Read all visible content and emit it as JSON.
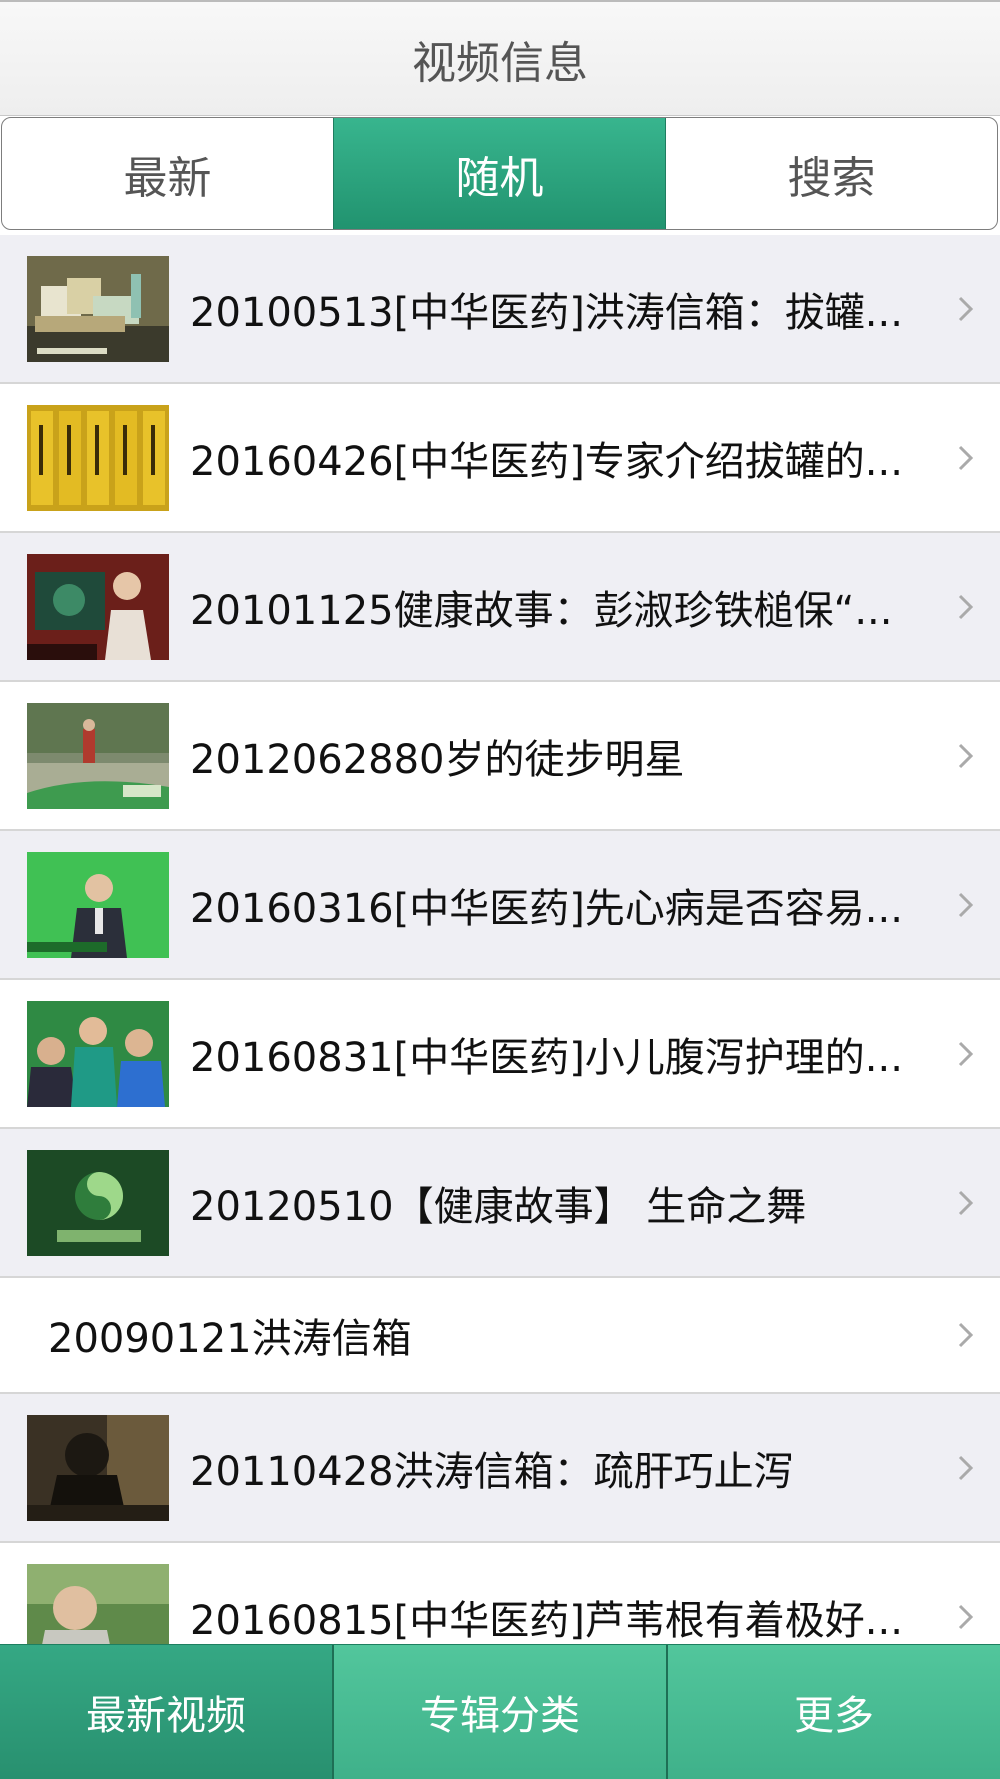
{
  "header": {
    "title": "视频信息"
  },
  "segments": [
    {
      "label": "最新",
      "active": false
    },
    {
      "label": "随机",
      "active": true
    },
    {
      "label": "搜索",
      "active": false
    }
  ],
  "videos": [
    {
      "title": "20100513[中华医药]洪涛信箱：拔罐...",
      "thumb": "product-boxes"
    },
    {
      "title": "20160426[中华医药]专家介绍拔罐的...",
      "thumb": "yellow-scrolls"
    },
    {
      "title": "20101125健康故事：彭淑珍铁槌保“...",
      "thumb": "host-studio"
    },
    {
      "title": "2012062880岁的徒步明星",
      "thumb": "walker-outdoor"
    },
    {
      "title": "20160316[中华医药]先心病是否容易...",
      "thumb": "doctor-green"
    },
    {
      "title": "20160831[中华医药]小儿腹泻护理的...",
      "thumb": "family-interview"
    },
    {
      "title": "20120510【健康故事】 生命之舞",
      "thumb": "program-logo"
    },
    {
      "title": "20090121洪涛信箱",
      "thumb": null
    },
    {
      "title": "20110428洪涛信箱：疏肝巧止泻",
      "thumb": "dark-interview"
    },
    {
      "title": "20160815[中华医药]芦苇根有着极好...",
      "thumb": "elder-outdoor"
    }
  ],
  "tabbar": [
    {
      "label": "最新视频",
      "active": true
    },
    {
      "label": "专辑分类",
      "active": false
    },
    {
      "label": "更多",
      "active": false
    }
  ],
  "colors": {
    "accent": "#2aa07c",
    "tab": "#4bbf95"
  }
}
